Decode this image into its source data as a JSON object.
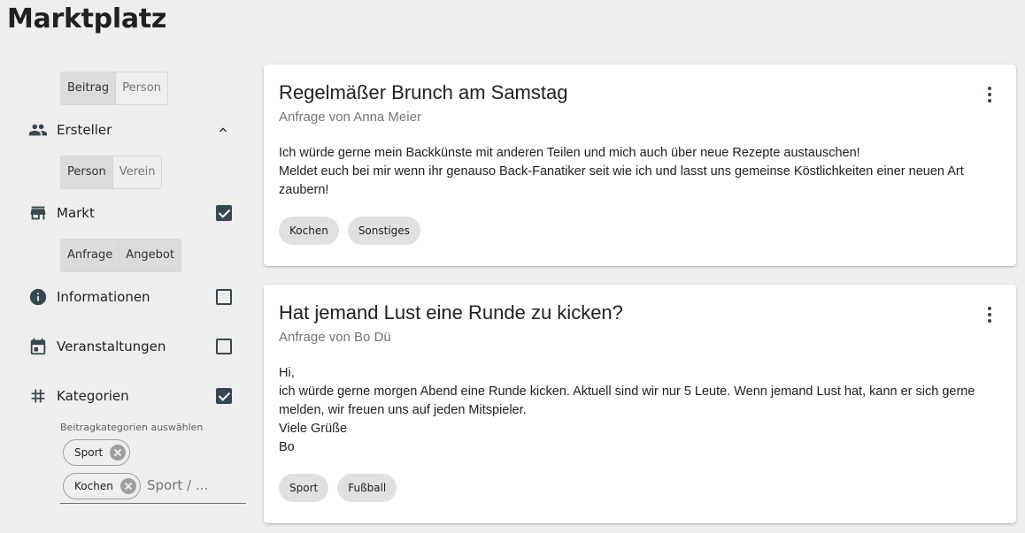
{
  "page_title": "Marktplatz",
  "sidebar": {
    "type_toggle": {
      "options": [
        "Beitrag",
        "Person"
      ],
      "selected": "Beitrag"
    },
    "ersteller": {
      "label": "Ersteller",
      "expanded": true,
      "toggle": {
        "options": [
          "Person",
          "Verein"
        ],
        "selected": "Person"
      }
    },
    "markt": {
      "label": "Markt",
      "checked": true,
      "toggle": {
        "options": [
          "Anfrage",
          "Angebot"
        ],
        "selected": [
          "Anfrage",
          "Angebot"
        ]
      }
    },
    "informationen": {
      "label": "Informationen",
      "checked": false
    },
    "veranstaltungen": {
      "label": "Veranstaltungen",
      "checked": false
    },
    "kategorien": {
      "label": "Kategorien",
      "checked": true,
      "hint": "Beitragkategorien auswählen",
      "selected": [
        "Sport",
        "Kochen"
      ],
      "placeholder": "Sport / ..."
    }
  },
  "posts": [
    {
      "title": "Regelmäßer Brunch am Samstag",
      "subtitle": "Anfrage von Anna Meier",
      "body": [
        "Ich würde gerne mein Backkünste mit anderen Teilen und mich auch über neue Rezepte austauschen!",
        "Meldet euch bei mir wenn ihr genauso Back-Fanatiker seit wie ich und lasst uns gemeinse Köstlichkeiten einer neuen Art zaubern!"
      ],
      "tags": [
        "Kochen",
        "Sonstiges"
      ]
    },
    {
      "title": "Hat jemand Lust eine Runde zu kicken?",
      "subtitle": "Anfrage von Bo Dü",
      "body": [
        "Hi,",
        "ich würde gerne morgen Abend eine Runde kicken. Aktuell sind wir nur 5 Leute. Wenn jemand Lust hat, kann er sich gerne melden, wir freuen uns auf jeden Mitspieler.",
        "Viele Grüße",
        "Bo"
      ],
      "tags": [
        "Sport",
        "Fußball"
      ]
    }
  ],
  "icons": {
    "ersteller": "people-icon",
    "markt": "store-icon",
    "informationen": "info-icon",
    "veranstaltungen": "calendar-icon",
    "kategorien": "hashtag-icon",
    "menu": "more-vert-icon"
  },
  "colors": {
    "accent": "#37474f",
    "background": "#eeeeee",
    "card": "#ffffff"
  }
}
